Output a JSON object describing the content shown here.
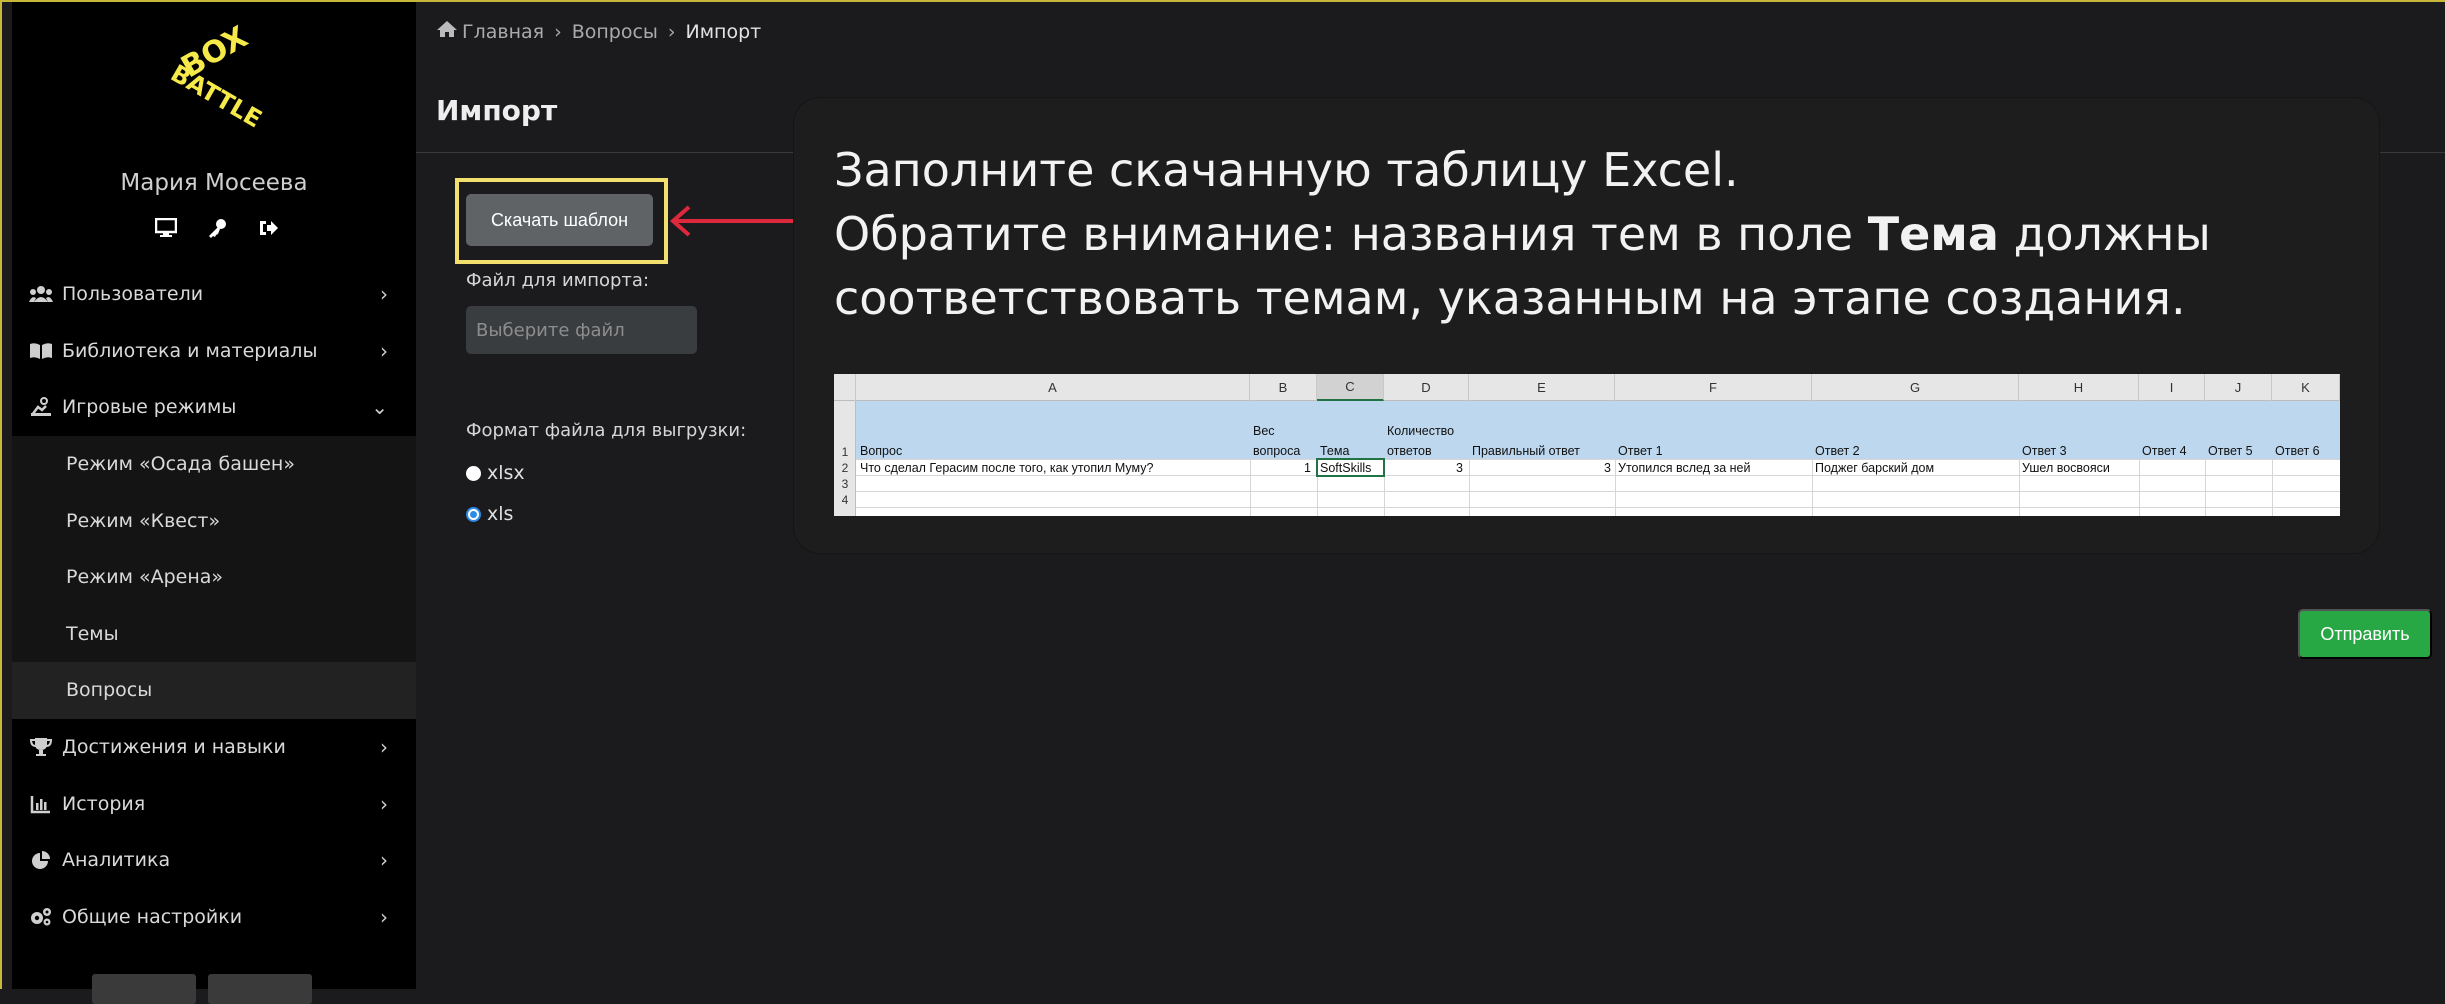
{
  "sidebar": {
    "logo_text": "BOX BATTLE",
    "user_name": "Мария Мосеева",
    "user_icons": [
      "monitor-icon",
      "key-icon",
      "sign-out-icon"
    ],
    "items": [
      {
        "label": "Пользователи",
        "icon": "users-icon"
      },
      {
        "label": "Библиотека и материалы",
        "icon": "book-icon"
      },
      {
        "label": "Игровые режимы",
        "icon": "gamepad-icon",
        "expanded": true
      },
      {
        "label": "Достижения и навыки",
        "icon": "trophy-icon"
      },
      {
        "label": "История",
        "icon": "chart-icon"
      },
      {
        "label": "Аналитика",
        "icon": "pie-icon"
      },
      {
        "label": "Общие настройки",
        "icon": "gears-icon"
      }
    ],
    "sub_items": [
      {
        "label": "Режим «Осада башен»"
      },
      {
        "label": "Режим «Квест»"
      },
      {
        "label": "Режим «Арена»"
      },
      {
        "label": "Темы"
      },
      {
        "label": "Вопросы",
        "active": true
      }
    ]
  },
  "breadcrumb": {
    "home": "Главная",
    "section": "Вопросы",
    "current": "Импорт",
    "separator": "›"
  },
  "page": {
    "title": "Импорт"
  },
  "form": {
    "download_button": "Скачать шаблон",
    "file_label": "Файл для импорта:",
    "file_placeholder": "Выберите файл",
    "format_label": "Формат файла для выгрузки:",
    "formats": [
      {
        "label": "xlsx",
        "checked": false
      },
      {
        "label": "xls",
        "checked": true
      }
    ],
    "submit_button": "Отправить"
  },
  "callout": {
    "line1": "Заполните скачанную таблицу Excel.",
    "line2_pre": "Обратите внимание: названия тем в поле ",
    "line2_bold": "Тема",
    "line2_post": " должны",
    "line3": "соответствовать темам, указанным на этапе создания."
  },
  "excel": {
    "columns": [
      "A",
      "B",
      "C",
      "D",
      "E",
      "F",
      "G",
      "H",
      "I",
      "J",
      "K"
    ],
    "selected_column": "C",
    "row_numbers": [
      "1",
      "2",
      "3",
      "4"
    ],
    "headers": {
      "A": "Вопрос",
      "B_top": "Вес",
      "B_bottom": "вопроса",
      "C": "Тема",
      "D_top": "Количество",
      "D_bottom": "ответов",
      "E": "Правильный ответ",
      "F": "Ответ 1",
      "G": "Ответ 2",
      "H": "Ответ 3",
      "I": "Ответ 4",
      "J": "Ответ 5",
      "K": "Ответ 6"
    },
    "row2": {
      "A": "Что сделал Герасим после того, как утопил Муму?",
      "B": "1",
      "C": "SoftSkills",
      "D": "3",
      "E": "3",
      "F": "Утопился вслед за ней",
      "G": "Поджег барский дом",
      "H": "Ушел восвояси"
    }
  },
  "colors": {
    "accent_highlight": "#f3df6d",
    "arrow": "#e0283c",
    "submit": "#28a745"
  }
}
